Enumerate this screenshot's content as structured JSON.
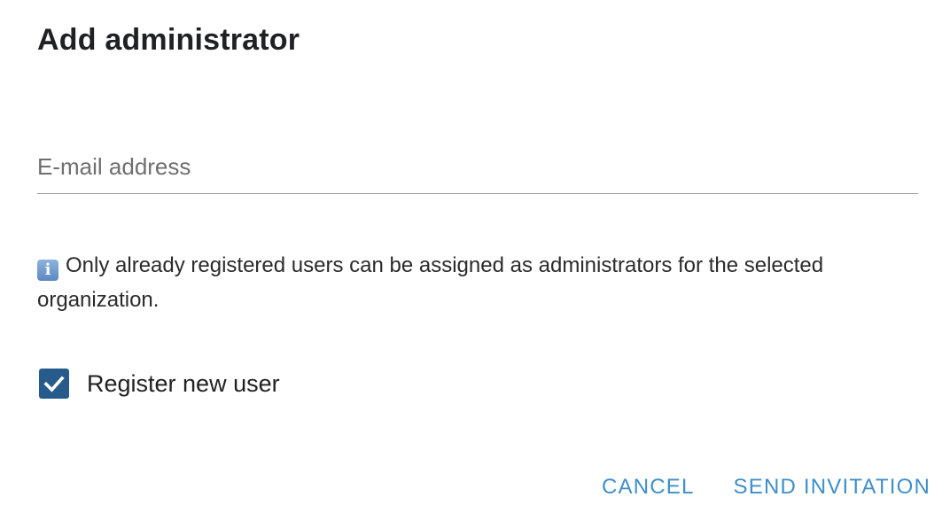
{
  "dialog": {
    "title": "Add administrator",
    "email": {
      "placeholder": "E-mail address",
      "value": ""
    },
    "info": {
      "icon": "info-icon",
      "icon_glyph": "i",
      "text": "Only already registered users can be assigned as administrators for the selected organization."
    },
    "register_checkbox": {
      "label": "Register new user",
      "checked": true,
      "color": "#265b8c"
    },
    "actions": {
      "cancel_label": "CANCEL",
      "send_label": "SEND INVITATION",
      "color": "#3f8fc9"
    }
  }
}
